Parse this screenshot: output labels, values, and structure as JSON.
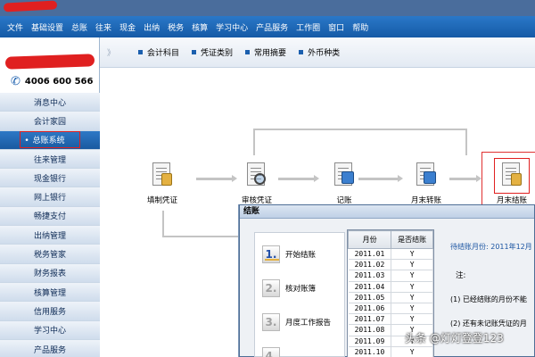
{
  "menu": [
    "文件",
    "基础设置",
    "总账",
    "往来",
    "现金",
    "出纳",
    "税务",
    "核算",
    "学习中心",
    "产品服务",
    "工作圈",
    "窗口",
    "帮助"
  ],
  "sidebar": {
    "phone": "4006 600 566",
    "items": [
      {
        "label": "消息中心",
        "active": false
      },
      {
        "label": "会计家园",
        "active": false
      },
      {
        "label": "总账系统",
        "active": true
      },
      {
        "label": "往来管理",
        "active": false
      },
      {
        "label": "现金银行",
        "active": false
      },
      {
        "label": "网上银行",
        "active": false
      },
      {
        "label": "畅捷支付",
        "active": false
      },
      {
        "label": "出纳管理",
        "active": false
      },
      {
        "label": "税务管家",
        "active": false
      },
      {
        "label": "财务报表",
        "active": false
      },
      {
        "label": "核算管理",
        "active": false
      },
      {
        "label": "信用服务",
        "active": false
      },
      {
        "label": "学习中心",
        "active": false
      },
      {
        "label": "产品服务",
        "active": false
      }
    ]
  },
  "quickbar": {
    "chevron": "》",
    "items": [
      "会计科目",
      "凭证类别",
      "常用摘要",
      "外币种类"
    ]
  },
  "flow": {
    "nodes": [
      "填制凭证",
      "审核凭证",
      "记账",
      "月末转账",
      "月末结账"
    ]
  },
  "dialog": {
    "title": "结账",
    "steps": [
      {
        "num": "1.",
        "label": "开始结账",
        "active": true
      },
      {
        "num": "2.",
        "label": "核对账簿",
        "active": false
      },
      {
        "num": "3.",
        "label": "月度工作报告",
        "active": false
      },
      {
        "num": "4.",
        "label": "",
        "active": false
      }
    ],
    "table": {
      "headers": [
        "月份",
        "是否结账"
      ],
      "rows": [
        [
          "2011.01",
          "Y"
        ],
        [
          "2011.02",
          "Y"
        ],
        [
          "2011.03",
          "Y"
        ],
        [
          "2011.04",
          "Y"
        ],
        [
          "2011.05",
          "Y"
        ],
        [
          "2011.06",
          "Y"
        ],
        [
          "2011.07",
          "Y"
        ],
        [
          "2011.08",
          "Y"
        ],
        [
          "2011.09",
          "Y"
        ],
        [
          "2011.10",
          "Y"
        ]
      ]
    },
    "right": {
      "month_text": "待结账月份: 2011年12月",
      "note": "注:",
      "line1": "(1) 已经结账的月份不能",
      "line2": "(2) 还有未记账凭证的月"
    }
  },
  "watermark": "头条 @灯灯登登123"
}
